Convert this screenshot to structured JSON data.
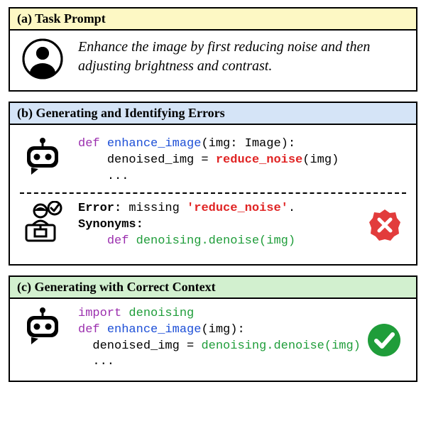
{
  "panel_a": {
    "title": "(a) Task Prompt",
    "prompt": "Enhance the image by first reducing noise and then adjusting brightness and contrast."
  },
  "panel_b": {
    "title": "(b) Generating and Identifying Errors",
    "code_gen": {
      "def": "def",
      "fn": "enhance_image",
      "sig_open": "(img: Image):",
      "line2_lhs": "denoised_img = ",
      "line2_call": "reduce_noise",
      "line2_arg": "(img)",
      "ellipsis": "..."
    },
    "error": {
      "label": "Error:",
      "msg1": " missing ",
      "missing": "'reduce_noise'",
      "dot": ".",
      "syn_label": "Synonyms:",
      "def": "def",
      "fix": "denoising.denoise(img)"
    }
  },
  "panel_c": {
    "title": "(c) Generating with Correct Context",
    "code": {
      "import": "import",
      "module": "denoising",
      "def": "def",
      "fn": "enhance_image",
      "sig_open": "(img):",
      "line3_lhs": "denoised_img = ",
      "line3_call": "denoising.denoise(img)",
      "ellipsis": "..."
    }
  }
}
